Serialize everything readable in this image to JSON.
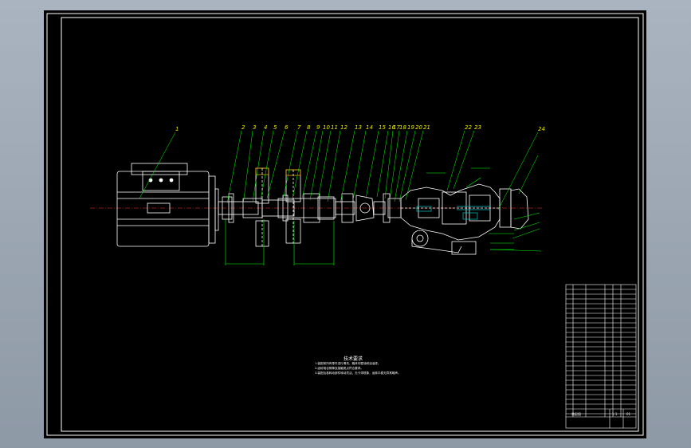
{
  "drawing": {
    "background": "#000000",
    "frame_color": "#ffffff",
    "part_color": "#ffffff",
    "annotation_color": "#00ff00",
    "centerline_color": "#ff3030",
    "callout_color": "#e8e800",
    "shaded_color": "#00c8c8",
    "balloon_numbers": [
      "1",
      "2",
      "3",
      "4",
      "5",
      "6",
      "7",
      "8",
      "9",
      "10",
      "11",
      "12",
      "13",
      "14",
      "15",
      "16",
      "17",
      "18",
      "19",
      "20",
      "21",
      "22",
      "23",
      "24"
    ],
    "technical_requirements": {
      "title": "技术要求",
      "lines": [
        "1.装配前所有零件进行清洗，箱体内壁涂耐油油漆。",
        "2.齿轮啮合侧隙及接触斑点符合要求。",
        "3.装配后各转动部件转动灵活，无卡滞现象，运转平稳无异常噪声。"
      ]
    },
    "title_block": {
      "sheet_label": "装配图",
      "scale": "1:1",
      "sheet_no": "01"
    }
  }
}
